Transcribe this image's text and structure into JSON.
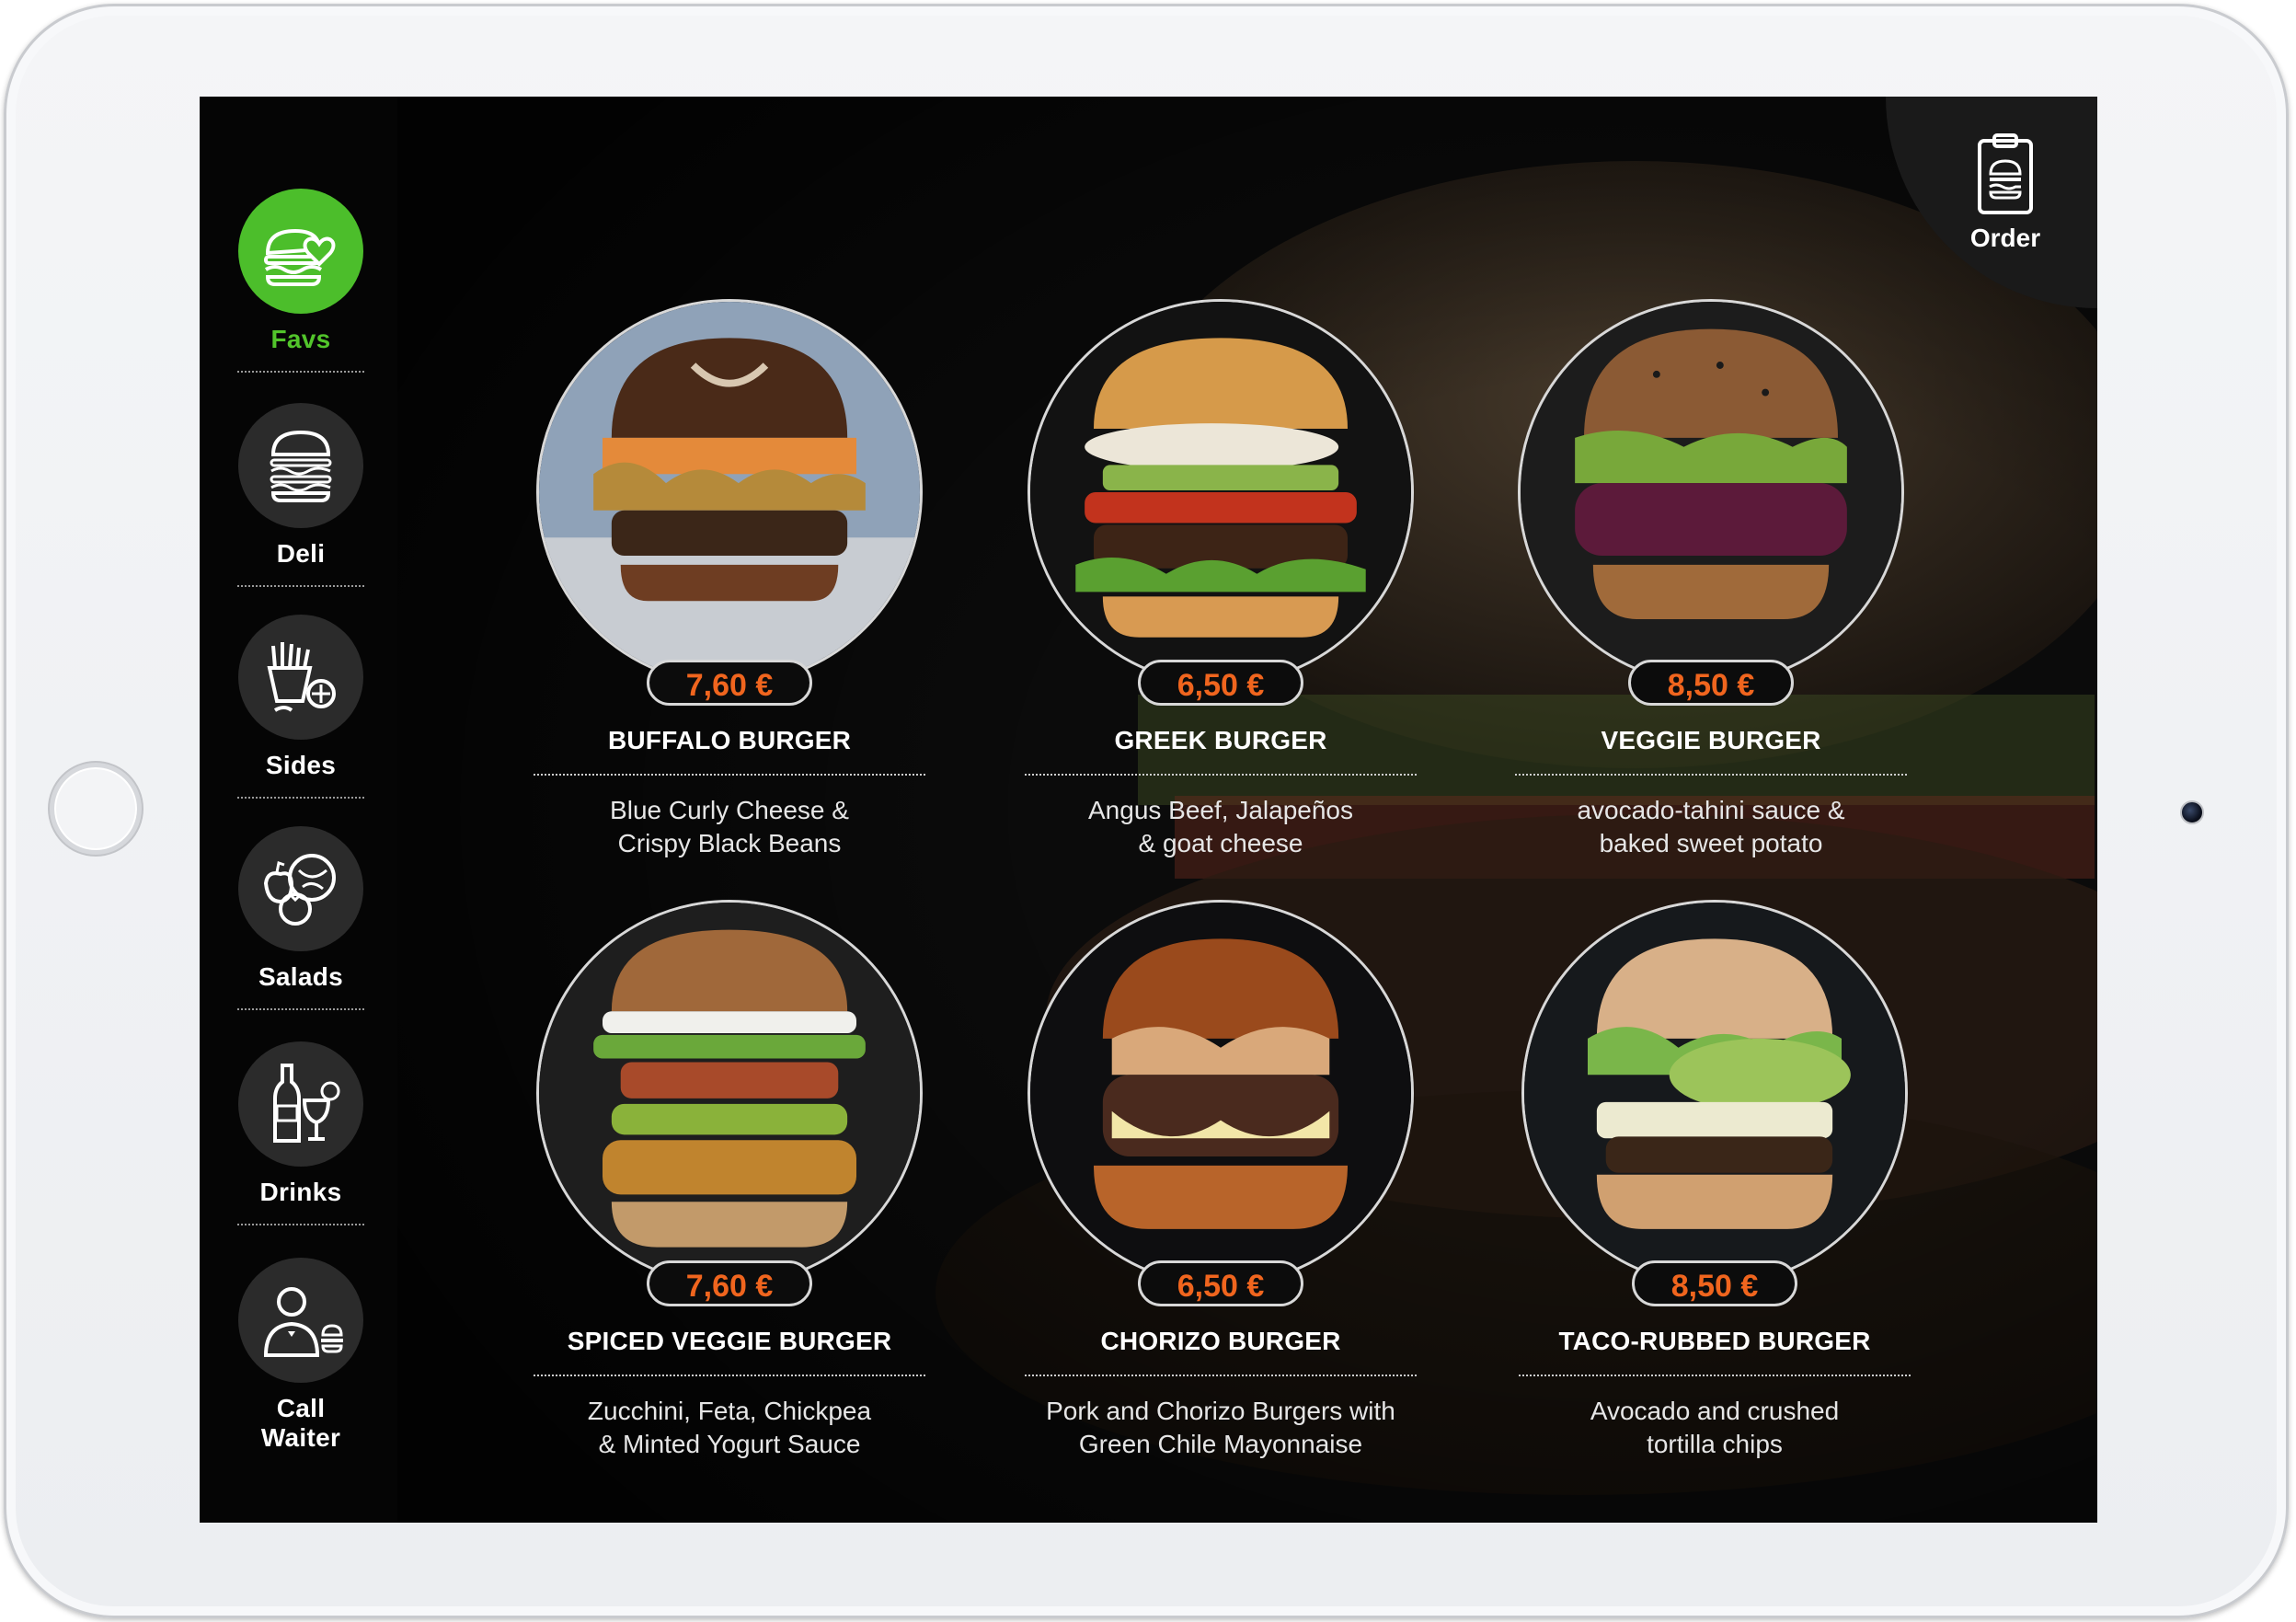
{
  "nav": {
    "items": [
      {
        "label": "Favs",
        "icon": "burger-heart-icon",
        "active": true
      },
      {
        "label": "Deli",
        "icon": "burger-stack-icon",
        "active": false
      },
      {
        "label": "Sides",
        "icon": "fries-icon",
        "active": false
      },
      {
        "label": "Salads",
        "icon": "vegetables-icon",
        "active": false
      },
      {
        "label": "Drinks",
        "icon": "drinks-icon",
        "active": false
      },
      {
        "label": "Call Waiter",
        "icon": "waiter-icon",
        "active": false
      }
    ]
  },
  "order": {
    "label": "Order",
    "icon": "clipboard-burger-icon"
  },
  "products": [
    {
      "name": "BUFFALO BURGER",
      "price": "7,60 €",
      "desc1": "Blue Curly Cheese &",
      "desc2": "Crispy Black Beans"
    },
    {
      "name": "GREEK BURGER",
      "price": "6,50 €",
      "desc1": "Angus Beef, Jalapeños",
      "desc2": "& goat cheese"
    },
    {
      "name": "VEGGIE BURGER",
      "price": "8,50 €",
      "desc1": "avocado-tahini sauce &",
      "desc2": "baked sweet potato"
    },
    {
      "name": "SPICED VEGGIE BURGER",
      "price": "7,60 €",
      "desc1": "Zucchini, Feta, Chickpea",
      "desc2": "& Minted Yogurt Sauce"
    },
    {
      "name": "CHORIZO BURGER",
      "price": "6,50 €",
      "desc1": "Pork and Chorizo Burgers with",
      "desc2": "Green Chile Mayonnaise"
    },
    {
      "name": "TACO-RUBBED BURGER",
      "price": "8,50 €",
      "desc1": "Avocado and crushed",
      "desc2": "tortilla chips"
    }
  ],
  "colors": {
    "accent": "#4cbe2b",
    "price": "#f0651e",
    "background": "#0a0a0a"
  }
}
